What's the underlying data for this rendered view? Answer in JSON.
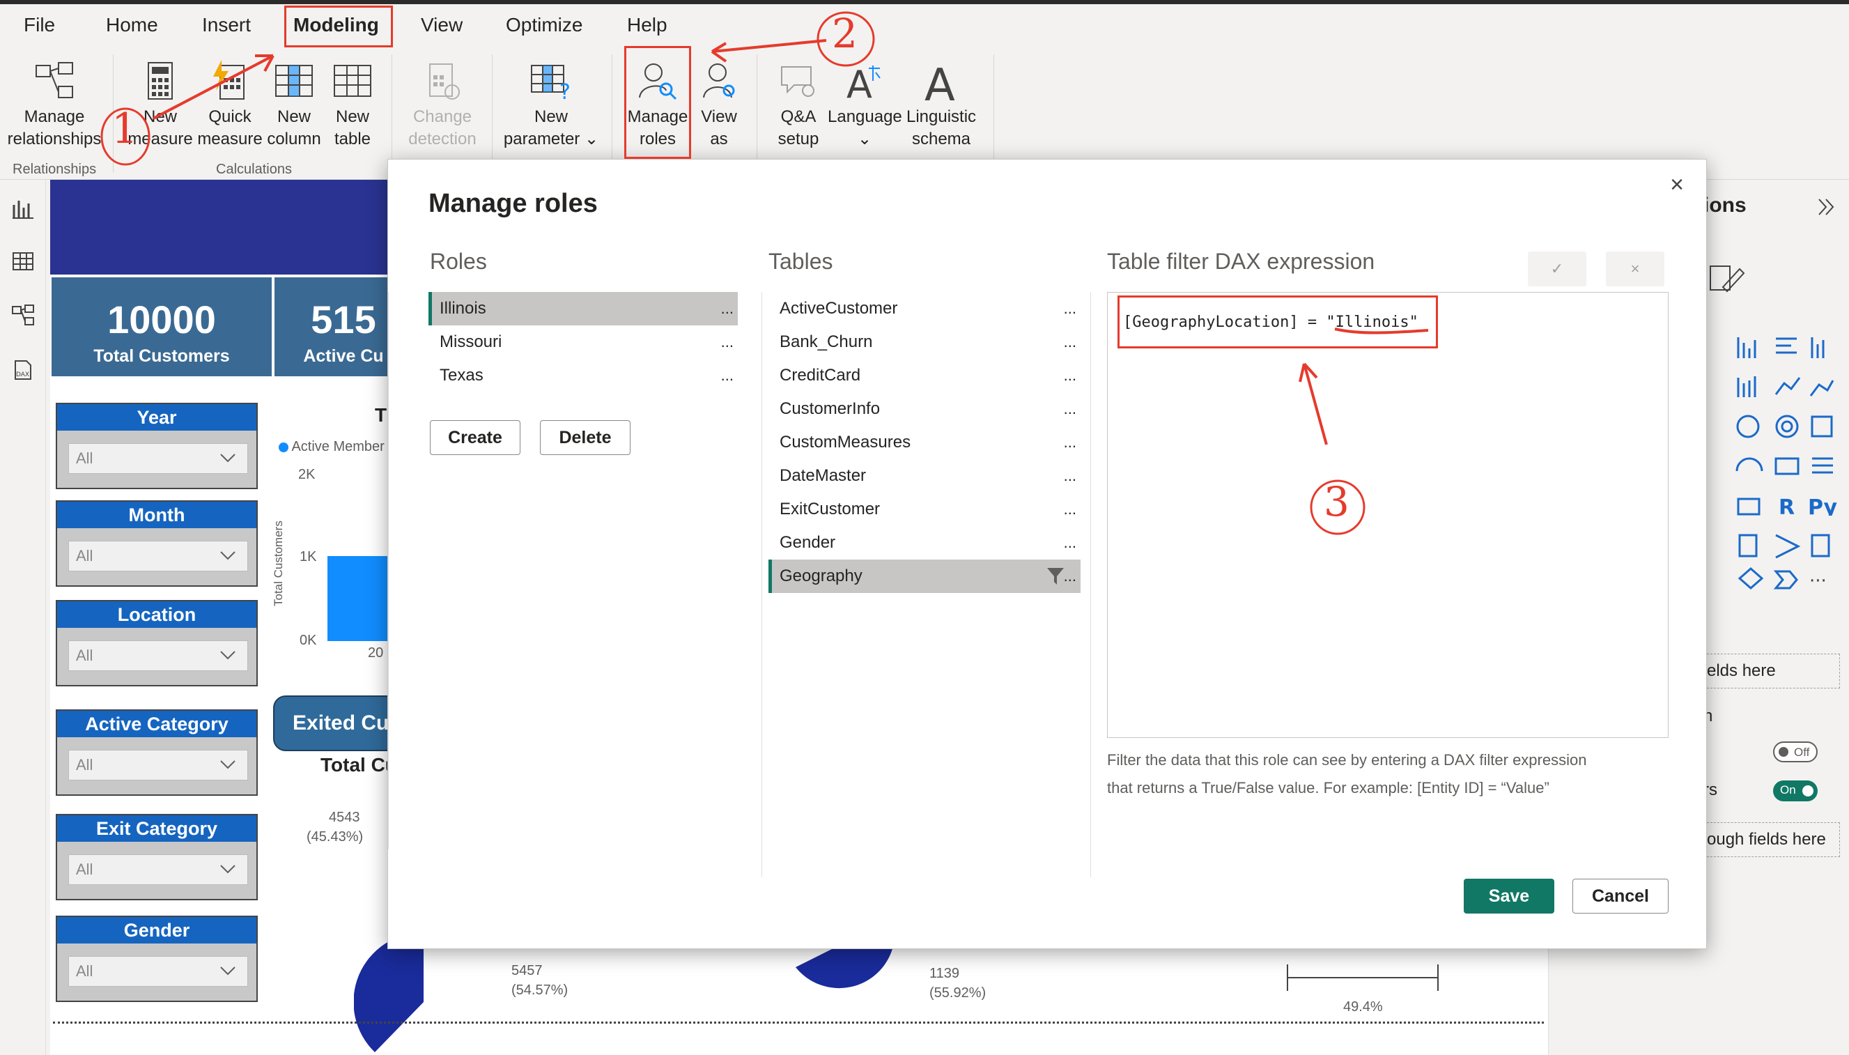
{
  "menu": {
    "items": [
      {
        "label": "File",
        "x": 34
      },
      {
        "label": "Home",
        "x": 152
      },
      {
        "label": "Insert",
        "x": 290
      },
      {
        "label": "Modeling",
        "x": 421,
        "active": true
      },
      {
        "label": "View",
        "x": 604
      },
      {
        "label": "Optimize",
        "x": 726
      },
      {
        "label": "Help",
        "x": 900
      }
    ]
  },
  "ribbon": {
    "manage_relationships": [
      "Manage",
      "relationships"
    ],
    "new_measure": [
      "New",
      "measure"
    ],
    "quick_measure": [
      "Quick",
      "measure"
    ],
    "new_column": [
      "New",
      "column"
    ],
    "new_table": [
      "New",
      "table"
    ],
    "change_detection": [
      "Change",
      "detection"
    ],
    "new_parameter": [
      "New",
      "parameter ⌄"
    ],
    "manage_roles": [
      "Manage",
      "roles"
    ],
    "view_as": [
      "View",
      "as"
    ],
    "qa_setup": [
      "Q&A",
      "setup"
    ],
    "language": [
      "Language",
      "⌄"
    ],
    "linguistic_schema": [
      "Linguistic",
      "schema ⌄"
    ],
    "group_relationships": "Relationships",
    "group_calculations": "Calculations"
  },
  "report": {
    "kpi_total_customers_value": "10000",
    "kpi_total_customers_label": "Total Customers",
    "kpi_active_value": "515",
    "kpi_active_label": "Active Cu",
    "slicers": [
      {
        "title": "Year",
        "value": "All"
      },
      {
        "title": "Month",
        "value": "All"
      },
      {
        "title": "Location",
        "value": "All"
      },
      {
        "title": "Active Category",
        "value": "All"
      },
      {
        "title": "Exit Category",
        "value": "All"
      },
      {
        "title": "Gender",
        "value": "All"
      }
    ],
    "chart_title_fragment": "T",
    "legend_active_member": "Active Member",
    "y_ticks": [
      "2K",
      "1K",
      "0K"
    ],
    "y_axis_label": "Total Customers",
    "x_tick_fragment": "20",
    "exited_button": "Exited Cu",
    "total_cu_fragment": "Total Cu",
    "pie1_label_top": "4543",
    "pie1_label_top_pct": "(45.43%)",
    "pie1_label_bottom": "5457",
    "pie1_label_bottom_pct": "(54.57%)",
    "pie2_label_bottom": "1139",
    "pie2_label_bottom_pct": "(55.92%)",
    "bar3_label": "49.4%"
  },
  "right_pane": {
    "header_fragment": "ions",
    "fields_here": "elds here",
    "toggle_off": "Off",
    "toggle_on": "On",
    "drillthrough_fields": "ough fields here",
    "frag_n": "n",
    "frag_rs": "rs"
  },
  "dialog": {
    "title": "Manage roles",
    "roles_heading": "Roles",
    "tables_heading": "Tables",
    "dax_heading": "Table filter DAX expression",
    "roles": [
      "Illinois",
      "Missouri",
      "Texas"
    ],
    "selected_role": "Illinois",
    "tables": [
      "ActiveCustomer",
      "Bank_Churn",
      "CreditCard",
      "CustomerInfo",
      "CustomMeasures",
      "DateMaster",
      "ExitCustomer",
      "Gender",
      "Geography"
    ],
    "selected_table": "Geography",
    "more_label": "...",
    "dax_expression": "[GeographyLocation] = \"Illinois\"",
    "help_text_line1": "Filter the data that this role can see by entering a DAX filter expression",
    "help_text_line2": "that returns a True/False value. For example: [Entity ID] = “Value”",
    "create_label": "Create",
    "delete_label": "Delete",
    "save_label": "Save",
    "cancel_label": "Cancel",
    "accept_label": "✓",
    "discard_label": "×",
    "close_label": "×"
  },
  "annotations": {
    "one": "1",
    "two": "2",
    "three": "3"
  },
  "colors": {
    "accent": "#117865",
    "annotation": "#e53b2c",
    "slicer_header": "#1565c0",
    "kpi": "#3a6a93",
    "banner": "#2a3391"
  }
}
